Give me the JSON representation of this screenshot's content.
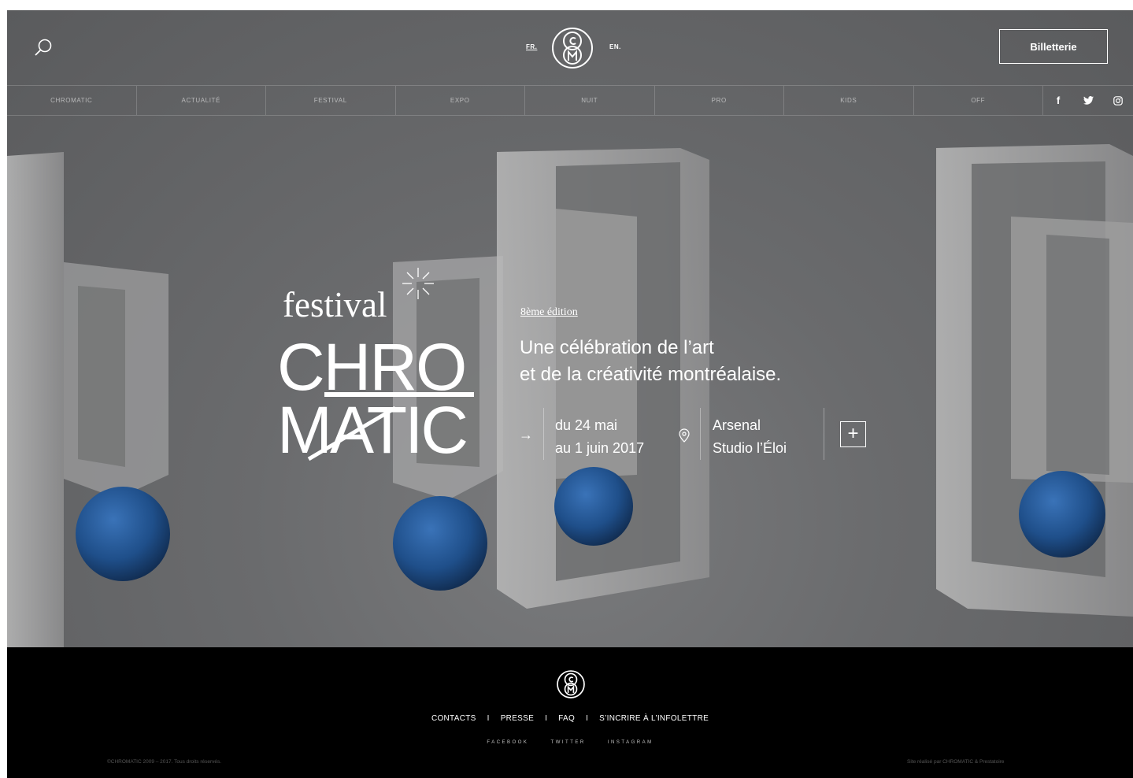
{
  "header": {
    "lang_fr": "FR.",
    "lang_en": "EN.",
    "ticket_label": "Billetterie"
  },
  "nav": {
    "items": [
      "CHROMATIC",
      "ACTUALITÉ",
      "FESTIVAL",
      "EXPO",
      "NUIT",
      "PRO",
      "KIDS",
      "OFF"
    ],
    "social": [
      "f",
      "twitter",
      "instagram"
    ]
  },
  "hero": {
    "festival_word": "festival",
    "logo_line1": "CHRO",
    "logo_line2": "MATIC",
    "edition": "8ème édition",
    "tagline_line1": "Une célébration de l’art",
    "tagline_line2": "et de la créativité montréalaise.",
    "dates_line1": "du 24 mai",
    "dates_line2": "au 1 juin 2017",
    "venue_line1": "Arsenal",
    "venue_line2": "Studio l’Éloi",
    "plus": "+"
  },
  "footer": {
    "links": [
      "CONTACTS",
      "PRESSE",
      "FAQ",
      "S’INCRIRE À L’INFOLETTRE"
    ],
    "separator": "I",
    "social": [
      "FACEBOOK",
      "TWITTER",
      "INSTAGRAM"
    ],
    "copyright": "©CHROMATIC 2009 – 2017. Tous droits réservés.",
    "credit": "Site réalisé par CHROMATIC & Prestatoire"
  },
  "colors": {
    "hero_bg": "#6a6b6d",
    "sphere_blue": "#1f4f8a",
    "footer_bg": "#000000",
    "text": "#ffffff"
  }
}
